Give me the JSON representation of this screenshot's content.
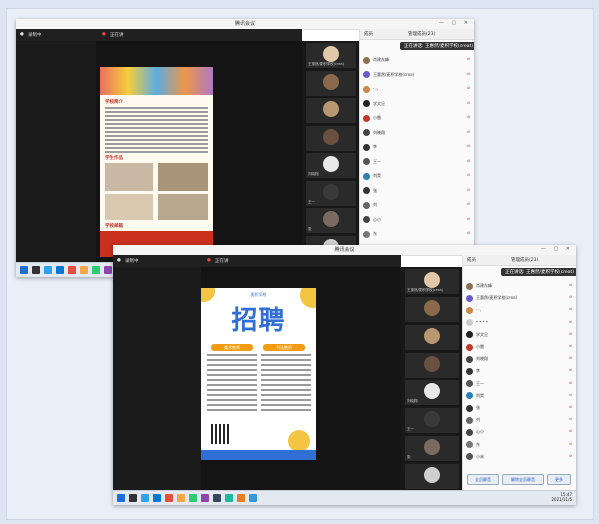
{
  "app": {
    "window_title": "腾讯会议",
    "window_controls": "— ▢ ✕",
    "recording_label": "录制中",
    "share_label": "正在讲"
  },
  "screen1": {
    "participants_tab": "成员",
    "participants_count_label": "管理成员(23)",
    "popup_text": "正在讲话: 王惠然/麦积学校(creat)",
    "participants": [
      {
        "name": "肖建东峰",
        "avatar_color": "#8e6e4e",
        "icon": "mic-off"
      },
      {
        "name": "王惠然/麦积学校(crea)",
        "avatar_color": "#6a5acd",
        "icon": "mic-off"
      },
      {
        "name": "·.·,",
        "avatar_color": "#cc8844",
        "icon": "mic-off"
      },
      {
        "name": "学文旦",
        "avatar_color": "#222",
        "icon": "mic-off"
      },
      {
        "name": "小雷",
        "avatar_color": "#c0392b",
        "icon": "mic-off"
      },
      {
        "name": "刘晓翔",
        "avatar_color": "#444",
        "icon": "mic-off"
      },
      {
        "name": "李",
        "avatar_color": "#333",
        "icon": "mic-off"
      },
      {
        "name": "王一",
        "avatar_color": "#555",
        "icon": "mic-off"
      },
      {
        "name": "刘昊",
        "avatar_color": "#2980b9",
        "icon": "mic-off"
      },
      {
        "name": "张",
        "avatar_color": "#333",
        "icon": "mic-off"
      },
      {
        "name": "刘",
        "avatar_color": "#666",
        "icon": "mic-off"
      },
      {
        "name": "心小",
        "avatar_color": "#444",
        "icon": "mic-off"
      },
      {
        "name": "东",
        "avatar_color": "#777",
        "icon": "mic-off"
      },
      {
        "name": "小米",
        "avatar_color": "#555",
        "icon": "mic-off"
      }
    ],
    "thumbs": [
      {
        "name": "王惠然/麦积学校(crea)",
        "color": "#e0c8a8"
      },
      {
        "name": "",
        "color": "#8a6a4a"
      },
      {
        "name": "",
        "color": "#b89870"
      },
      {
        "name": "",
        "color": "#6a5040"
      },
      {
        "name": "刘晓翔",
        "color": "#e8e8e8"
      },
      {
        "name": "王一",
        "color": "#3a3a3a"
      },
      {
        "name": "张",
        "color": "#7a6a60"
      },
      {
        "name": "",
        "color": "#cfcfcf"
      }
    ],
    "poster": {
      "heading1": "学校简介",
      "heading2": "学生作品",
      "heading3": "学校邮箱"
    }
  },
  "screen2": {
    "participants_tab": "成员",
    "participants_count_label": "管理成员(23)",
    "popup_text": "正在讲话: 王惠然/麦积学校(creat)",
    "poster_title": "招聘",
    "poster_sub": "麦积学校",
    "pill_left": "美术教师",
    "pill_right": "书法教师",
    "participants": [
      {
        "name": "肖建东峰",
        "avatar_color": "#8e6e4e"
      },
      {
        "name": "王惠然/麦积学校(crea)",
        "avatar_color": "#6a5acd"
      },
      {
        "name": "·.·,",
        "avatar_color": "#cc8844"
      },
      {
        "name": "* * * *",
        "avatar_color": "#ccc"
      },
      {
        "name": "学文旦",
        "avatar_color": "#222"
      },
      {
        "name": "小雷",
        "avatar_color": "#c0392b"
      },
      {
        "name": "刘晓翔",
        "avatar_color": "#444"
      },
      {
        "name": "李",
        "avatar_color": "#333"
      },
      {
        "name": "王一",
        "avatar_color": "#555"
      },
      {
        "name": "刘昊",
        "avatar_color": "#2980b9"
      },
      {
        "name": "张",
        "avatar_color": "#333"
      },
      {
        "name": "刘",
        "avatar_color": "#666"
      },
      {
        "name": "心小",
        "avatar_color": "#444"
      },
      {
        "name": "东",
        "avatar_color": "#777"
      },
      {
        "name": "小米",
        "avatar_color": "#555"
      }
    ],
    "thumbs": [
      {
        "name": "王惠然/麦积学校(crea)",
        "color": "#e0c8a8"
      },
      {
        "name": "",
        "color": "#8a6a4a"
      },
      {
        "name": "",
        "color": "#b89870"
      },
      {
        "name": "",
        "color": "#6a5040"
      },
      {
        "name": "刘晓翔",
        "color": "#e8e8e8"
      },
      {
        "name": "王一",
        "color": "#3a3a3a"
      },
      {
        "name": "张",
        "color": "#7a6a60"
      },
      {
        "name": "",
        "color": "#cfcfcf"
      }
    ],
    "bottom_buttons": [
      "全员静音",
      "解除全员静音",
      "更多"
    ],
    "clock_time": "15:47",
    "clock_date": "2021/11/5"
  }
}
